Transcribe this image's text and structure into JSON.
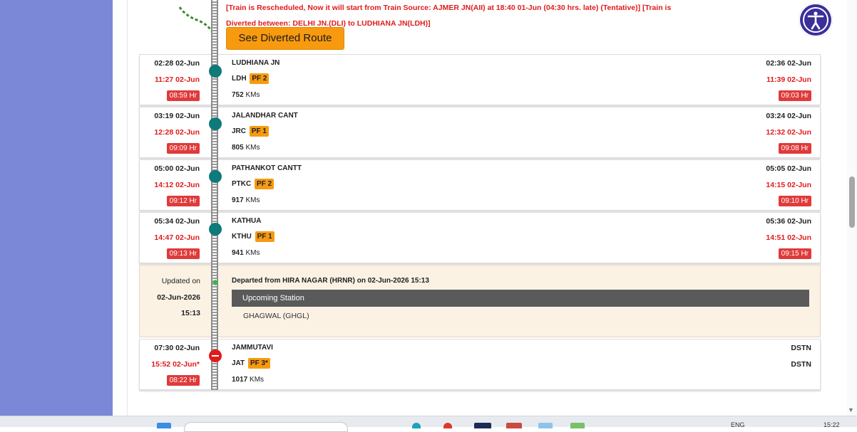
{
  "alert": {
    "line1": "[Train is Rescheduled, Now it will start from Train Source: AJMER JN(AII) at 18:40 01-Jun (04:30 hrs. late) (Tentative)] [Train is",
    "line2": "Diverted between: DELHI JN.(DLI) to LUDHIANA JN(LDH)]"
  },
  "divert_button": "See Diverted Route",
  "stations": [
    {
      "arr_sched": "02:28 02-Jun",
      "arr_actual": "11:27 02-Jun",
      "arr_delay": "08:59 Hr",
      "name": "LUDHIANA JN",
      "code": "LDH",
      "pf": "PF 2",
      "km": "752",
      "km_unit": "KMs",
      "dep_sched": "02:36 02-Jun",
      "dep_actual": "11:39 02-Jun",
      "dep_delay": "09:03 Hr"
    },
    {
      "arr_sched": "03:19 02-Jun",
      "arr_actual": "12:28 02-Jun",
      "arr_delay": "09:09 Hr",
      "name": "JALANDHAR CANT",
      "code": "JRC",
      "pf": "PF 1",
      "km": "805",
      "km_unit": "KMs",
      "dep_sched": "03:24 02-Jun",
      "dep_actual": "12:32 02-Jun",
      "dep_delay": "09:08 Hr"
    },
    {
      "arr_sched": "05:00 02-Jun",
      "arr_actual": "14:12 02-Jun",
      "arr_delay": "09:12 Hr",
      "name": "PATHANKOT CANTT",
      "code": "PTKC",
      "pf": "PF 2",
      "km": "917",
      "km_unit": "KMs",
      "dep_sched": "05:05 02-Jun",
      "dep_actual": "14:15 02-Jun",
      "dep_delay": "09:10 Hr"
    },
    {
      "arr_sched": "05:34 02-Jun",
      "arr_actual": "14:47 02-Jun",
      "arr_delay": "09:13 Hr",
      "name": "KATHUA",
      "code": "KTHU",
      "pf": "PF 1",
      "km": "941",
      "km_unit": "KMs",
      "dep_sched": "05:36 02-Jun",
      "dep_actual": "14:51 02-Jun",
      "dep_delay": "09:15 Hr"
    }
  ],
  "live": {
    "updated_label": "Updated on",
    "updated_date": "02-Jun-2026",
    "updated_time": "15:13",
    "departed": "Departed from HIRA NAGAR (HRNR) on 02-Jun-2026 15:13",
    "upcoming_label": "Upcoming Station",
    "upcoming_station": "GHAGWAL (GHGL)"
  },
  "destination": {
    "arr_sched": "07:30 02-Jun",
    "arr_actual": "15:52 02-Jun*",
    "arr_delay": "08:22 Hr",
    "name": "JAMMUTAVI",
    "code": "JAT",
    "pf": "PF 3*",
    "km": "1017",
    "km_unit": "KMs",
    "dep_sched": "DSTN",
    "dep_actual": "DSTN"
  },
  "taskbar": {
    "lang": "ENG",
    "time": "15:22"
  },
  "icons": {
    "accessibility": "accessibility-icon",
    "windows": "windows-start-icon"
  }
}
